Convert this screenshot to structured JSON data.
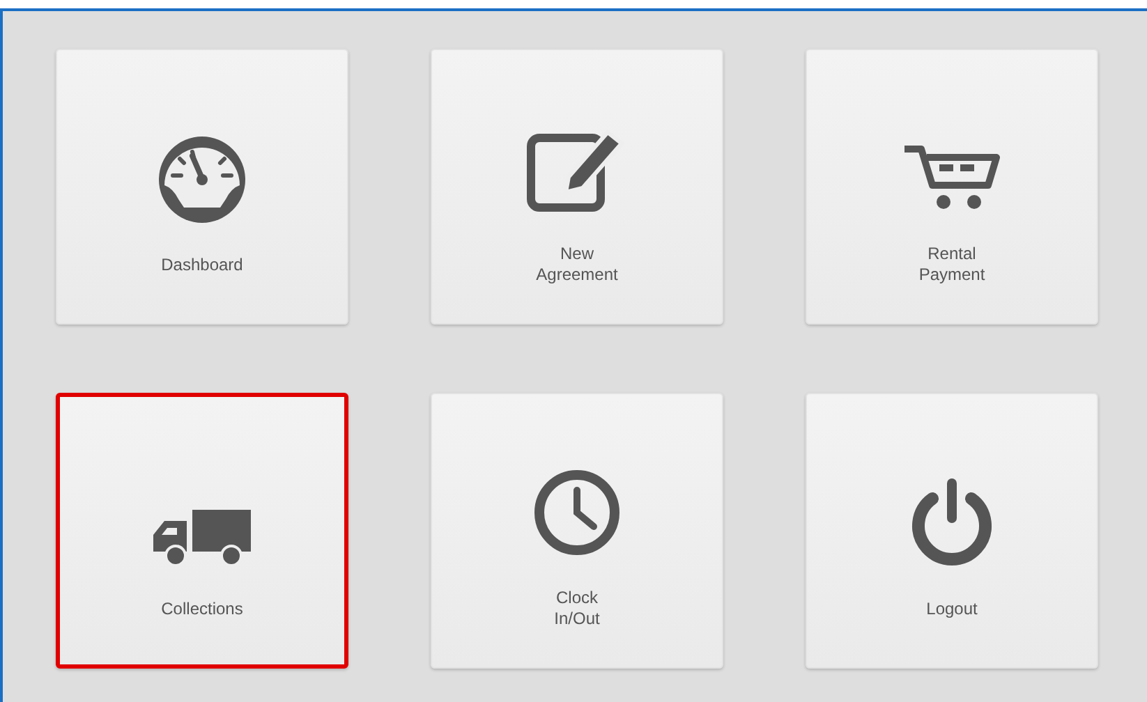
{
  "tiles": [
    {
      "kind": "gauge",
      "label": "Dashboard",
      "selected": false
    },
    {
      "kind": "edit",
      "label": "New\nAgreement",
      "selected": false
    },
    {
      "kind": "cart",
      "label": "Rental\nPayment",
      "selected": false
    },
    {
      "kind": "truck",
      "label": "Collections",
      "selected": true
    },
    {
      "kind": "clock",
      "label": "Clock\nIn/Out",
      "selected": false
    },
    {
      "kind": "power",
      "label": "Logout",
      "selected": false
    }
  ]
}
